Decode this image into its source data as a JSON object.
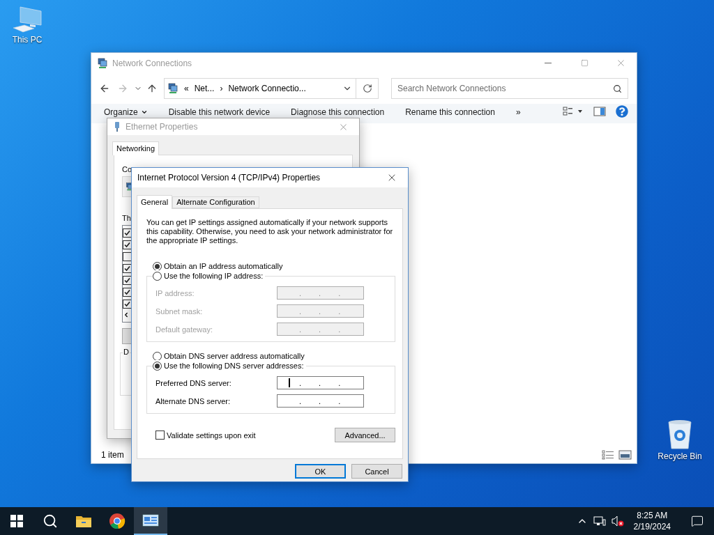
{
  "desktop_icons": [
    {
      "label": "This PC",
      "kind": "computer"
    },
    {
      "label": "Recycle Bin",
      "kind": "recycle-bin"
    }
  ],
  "explorer": {
    "title": "Network Connections",
    "active": false,
    "address": {
      "overflow": "«",
      "crumbs": [
        "Net...",
        "Network Connectio..."
      ],
      "separator": "›"
    },
    "search": {
      "placeholder": "Search Network Connections"
    },
    "commands": [
      {
        "label": "Organize",
        "kind": "menu"
      },
      {
        "label": "Disable this network device",
        "kind": "action"
      },
      {
        "label": "Diagnose this connection",
        "kind": "action"
      },
      {
        "label": "Rename this connection",
        "kind": "action"
      }
    ],
    "more": "»",
    "status": "1 item"
  },
  "ethernet": {
    "title": "Ethernet Properties",
    "active": false,
    "tabs": [
      {
        "label": "Networking",
        "selected": true
      }
    ],
    "connection_label": "Co",
    "components_label": "Th",
    "description_label": "D",
    "components": [
      {
        "checked": true
      },
      {
        "checked": true
      },
      {
        "checked": false
      },
      {
        "checked": true
      },
      {
        "checked": true
      },
      {
        "checked": true
      },
      {
        "checked": true
      }
    ]
  },
  "ipv4": {
    "title": "Internet Protocol Version 4 (TCP/IPv4) Properties",
    "tabs": [
      {
        "label": "General",
        "selected": true
      },
      {
        "label": "Alternate Configuration",
        "selected": false
      }
    ],
    "intro": "You can get IP settings assigned automatically if your network supports this capability. Otherwise, you need to ask your network administrator for the appropriate IP settings.",
    "ip_auto": {
      "label": "Obtain an IP address automatically",
      "selected": true
    },
    "ip_manual": {
      "label": "Use the following IP address:",
      "selected": false
    },
    "ip_fields": [
      {
        "label": "IP address:",
        "dots": [
          ".",
          ".",
          "."
        ],
        "disabled": true,
        "focused": false
      },
      {
        "label": "Subnet mask:",
        "dots": [
          ".",
          ".",
          "."
        ],
        "disabled": true,
        "focused": false
      },
      {
        "label": "Default gateway:",
        "dots": [
          ".",
          ".",
          "."
        ],
        "disabled": true,
        "focused": false
      }
    ],
    "dns_auto": {
      "label": "Obtain DNS server address automatically",
      "selected": false
    },
    "dns_manual": {
      "label": "Use the following DNS server addresses:",
      "selected": true
    },
    "dns_fields": [
      {
        "label": "Preferred DNS server:",
        "dots": [
          ".",
          ".",
          "."
        ],
        "disabled": false,
        "focused": true
      },
      {
        "label": "Alternate DNS server:",
        "dots": [
          ".",
          ".",
          "."
        ],
        "disabled": false,
        "focused": false
      }
    ],
    "validate": {
      "label": "Validate settings upon exit",
      "checked": false
    },
    "advanced": "Advanced...",
    "buttons": [
      {
        "label": "OK",
        "default": true
      },
      {
        "label": "Cancel",
        "default": false
      }
    ]
  },
  "taskbar": {
    "apps": [
      {
        "kind": "start",
        "selected": false
      },
      {
        "kind": "search",
        "selected": false
      },
      {
        "kind": "folder",
        "selected": false
      },
      {
        "kind": "browser",
        "selected": false
      },
      {
        "kind": "network-settings",
        "selected": true
      }
    ],
    "time": "8:25 AM",
    "date": "2/19/2024"
  }
}
